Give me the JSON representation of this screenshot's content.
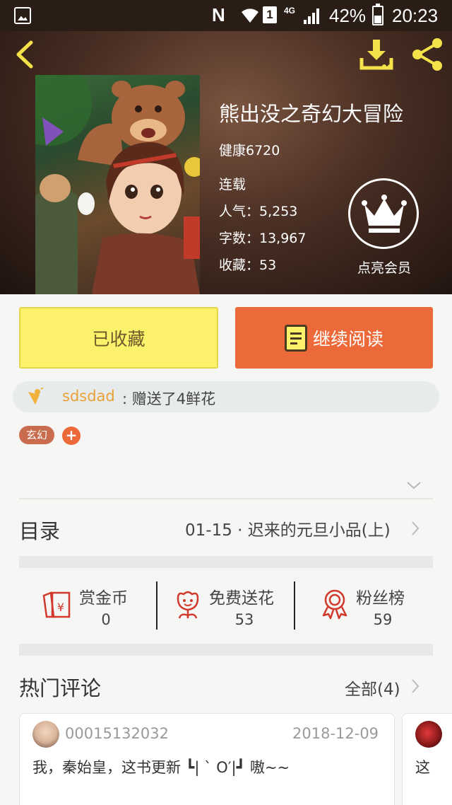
{
  "status_bar": {
    "nfc": "N",
    "sim": "1",
    "network": "4G",
    "battery": "42%",
    "time": "20:23"
  },
  "book": {
    "title": "熊出没之奇幻大冒险",
    "author": "健康6720",
    "status": "连载",
    "popularity": "人气：5,253",
    "word_count": "字数：13,967",
    "favorites": "收藏：53",
    "vip_label": "点亮会员"
  },
  "actions": {
    "favorited_label": "已收藏",
    "continue_label": "继续阅读"
  },
  "gift": {
    "user": "sdsdad",
    "text": ": 赠送了4鲜花"
  },
  "tags": [
    "玄幻"
  ],
  "tag_add": "+",
  "toc": {
    "label": "目录",
    "latest_chapter": "01-15 · 迟来的元旦小品(上)"
  },
  "stats": [
    {
      "label": "赏金币",
      "value": "0"
    },
    {
      "label": "免费送花",
      "value": "53"
    },
    {
      "label": "粉丝榜",
      "value": "59"
    }
  ],
  "comments": {
    "label": "热门评论",
    "all_label": "全部(4)",
    "items": [
      {
        "user": "00015132032",
        "date": "2018-12-09",
        "text": "我，秦始皇，这书更新 ┗| ` O′|┛ 嗷~~"
      },
      {
        "text": "这"
      }
    ]
  },
  "colors": {
    "favorited_bg": "#fcf16a",
    "continue_bg": "#ec6a3a",
    "icon_red": "#d0392b",
    "gift_user": "#e8a23a"
  },
  "icons": [
    "back-icon",
    "download-icon",
    "share-icon",
    "crown-icon",
    "book-icon",
    "flower-icon",
    "red-packet-icon",
    "fan-badge-icon",
    "chevron-right-icon",
    "chevron-down-icon"
  ]
}
